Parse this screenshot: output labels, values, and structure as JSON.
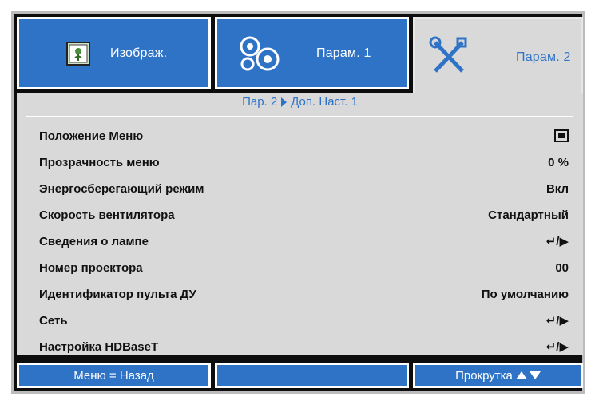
{
  "tabs": [
    {
      "label": "Изображ.",
      "icon": "picture-icon",
      "active": false
    },
    {
      "label": "Парам. 1",
      "icon": "gears-icon",
      "active": false
    },
    {
      "label": "Парам. 2",
      "icon": "tools-icon",
      "active": true
    }
  ],
  "breadcrumb": {
    "parent": "Пар. 2",
    "current": "Доп. Наст. 1"
  },
  "rows": [
    {
      "label": "Положение Меню",
      "value": "",
      "value_icon": "menu-position-icon"
    },
    {
      "label": "Прозрачность меню",
      "value": "0 %"
    },
    {
      "label": "Энергосберегающий режим",
      "value": "Вкл"
    },
    {
      "label": "Скорость вентилятора",
      "value": "Стандартный"
    },
    {
      "label": "Сведения о лампе",
      "value": "↵/▶"
    },
    {
      "label": "Номер проектора",
      "value": "00"
    },
    {
      "label": "Идентификатор пульта ДУ",
      "value": "По умолчанию"
    },
    {
      "label": "Сеть",
      "value": "↵/▶"
    },
    {
      "label": "Настройка HDBaseT",
      "value": "↵/▶"
    }
  ],
  "footer": {
    "left": "Меню = Назад",
    "middle": "",
    "right": "Прокрутка"
  },
  "colors": {
    "accent": "#2f73c7",
    "panel": "#d9d9d9",
    "frame": "#0d0d0d"
  }
}
